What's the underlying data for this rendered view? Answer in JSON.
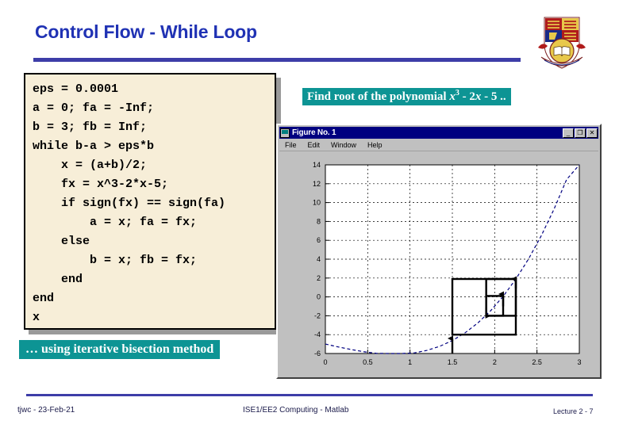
{
  "slide": {
    "title": "Control Flow - While Loop",
    "title_color": "#2032b4",
    "rule_color": "#3d3da8"
  },
  "logo": {
    "name": "imperial-college-crest",
    "alt": "Imperial College London crest"
  },
  "code_block": {
    "background": "#f7eed8",
    "text": "eps = 0.0001\na = 0; fa = -Inf;\nb = 3; fb = Inf;\nwhile b-a > eps*b\n    x = (a+b)/2;\n    fx = x^3-2*x-5;\n    if sign(fx) == sign(fa)\n        a = x; fa = fx;\n    else\n        b = x; fb = fx;\n    end\nend\nx"
  },
  "callouts": {
    "accent_color": "#0d9494",
    "polynomial_prefix": "Find root of the polynomial ",
    "polynomial_x1": "x",
    "polynomial_sup": "3",
    "polynomial_mid": " - 2",
    "polynomial_x2": "x",
    "polynomial_suffix": " - 5 ..",
    "bisection": "… using iterative bisection method"
  },
  "figure_window": {
    "title": "Figure No. 1",
    "app_icon": "matlab-figure-icon",
    "menu": [
      "File",
      "Edit",
      "Window",
      "Help"
    ],
    "window_buttons": [
      {
        "name": "minimize-button",
        "glyph": "_"
      },
      {
        "name": "maximize-button",
        "glyph": "❐"
      },
      {
        "name": "close-button",
        "glyph": "✕"
      }
    ]
  },
  "chart_data": {
    "type": "line",
    "title": "",
    "xlabel": "",
    "ylabel": "",
    "xlim": [
      0,
      3
    ],
    "ylim": [
      -6,
      14
    ],
    "xticks": [
      "0",
      "0.5",
      "1",
      "1.5",
      "2",
      "2.5",
      "3"
    ],
    "xtick_values": [
      0,
      0.5,
      1,
      1.5,
      2,
      2.5,
      3
    ],
    "yticks": [
      "14",
      "12",
      "10",
      "8",
      "6",
      "4",
      "2",
      "0",
      "-2",
      "-4",
      "-6"
    ],
    "ytick_values": [
      14,
      12,
      10,
      8,
      6,
      4,
      2,
      0,
      -2,
      -4,
      -6
    ],
    "grid": true,
    "legend": false,
    "series": [
      {
        "name": "x^3 - 2x - 5",
        "style": "dashed",
        "color": "#000080",
        "x": [
          0,
          0.15,
          0.3,
          0.45,
          0.6,
          0.75,
          0.9,
          1.05,
          1.2,
          1.35,
          1.5,
          1.65,
          1.8,
          1.95,
          2.1,
          2.25,
          2.4,
          2.55,
          2.7,
          2.85,
          3.0
        ],
        "y": [
          -5,
          -5.3,
          -5.57,
          -5.81,
          -5.98,
          -6.08,
          -6.07,
          -5.94,
          -5.67,
          -5.24,
          -4.63,
          -3.81,
          -2.77,
          -1.49,
          0.06,
          1.89,
          4.02,
          6.48,
          9.28,
          12.45,
          16.0
        ]
      }
    ],
    "annotations": {
      "type": "bisection-steps",
      "description": "Nested rectangle brackets with arrows showing successive bisection intervals converging on the root",
      "brackets": [
        {
          "x_left": 1.5,
          "x_right": 2.25,
          "y_bottom": -4,
          "y_top": 1.9
        },
        {
          "x_left": 1.9,
          "x_right": 2.25,
          "y_bottom": -2,
          "y_top": 1.9
        },
        {
          "x_left": 1.9,
          "x_right": 2.1,
          "y_bottom": -2,
          "y_top": 0.1
        }
      ],
      "arrows": [
        {
          "x": 1.5,
          "from_y": -6,
          "to_y": -4.4,
          "direction": "up"
        },
        {
          "x": 2.25,
          "from_y": 0.9,
          "to_y": 1.9,
          "direction": "up"
        },
        {
          "x": 1.9,
          "from_y": -1.1,
          "to_y": -2.0,
          "direction": "down"
        },
        {
          "x": 2.1,
          "from_y": -1.0,
          "to_y": 0.3,
          "direction": "up"
        }
      ]
    }
  },
  "footer": {
    "left": "tjwc - 23-Feb-21",
    "center": "ISE1/EE2 Computing - Matlab",
    "right": "Lecture 2 - 7"
  }
}
